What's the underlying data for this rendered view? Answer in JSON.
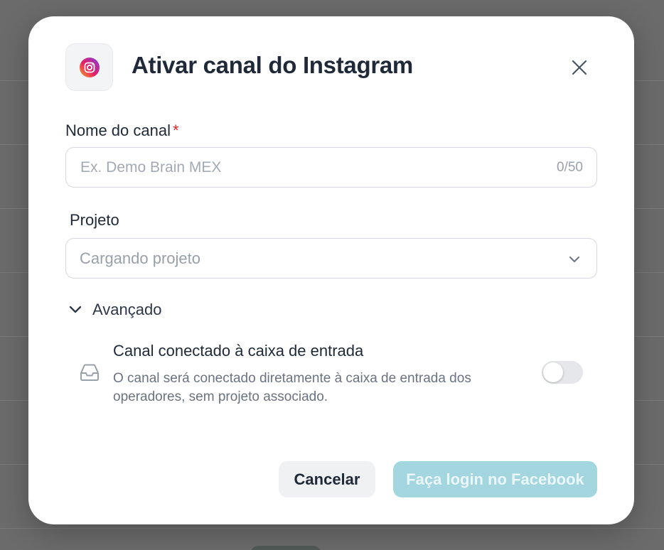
{
  "modal": {
    "title": "Ativar canal do Instagram",
    "icons": {
      "brand": "instagram-icon",
      "close": "close-icon"
    }
  },
  "form": {
    "channel_name": {
      "label": "Nome do canal",
      "required_mark": "*",
      "placeholder": "Ex. Demo Brain MEX",
      "value": "",
      "counter": "0/50"
    },
    "project": {
      "label": "Projeto",
      "selected_value": "Cargando projeto",
      "icon": "chevron-down-icon"
    },
    "advanced": {
      "label": "Avançado",
      "expanded": true,
      "icon": "chevron-down-icon",
      "inbox_option": {
        "icon": "inbox-icon",
        "title": "Canal conectado à caixa de entrada",
        "description": "O canal será conectado diretamente à caixa de entrada dos operadores, sem projeto associado.",
        "enabled": false
      }
    }
  },
  "footer": {
    "cancel_label": "Cancelar",
    "login_label": "Faça login no Facebook"
  },
  "colors": {
    "accent_disabled": "#a3d6de",
    "required": "#dc2626",
    "title": "#1f2937"
  }
}
